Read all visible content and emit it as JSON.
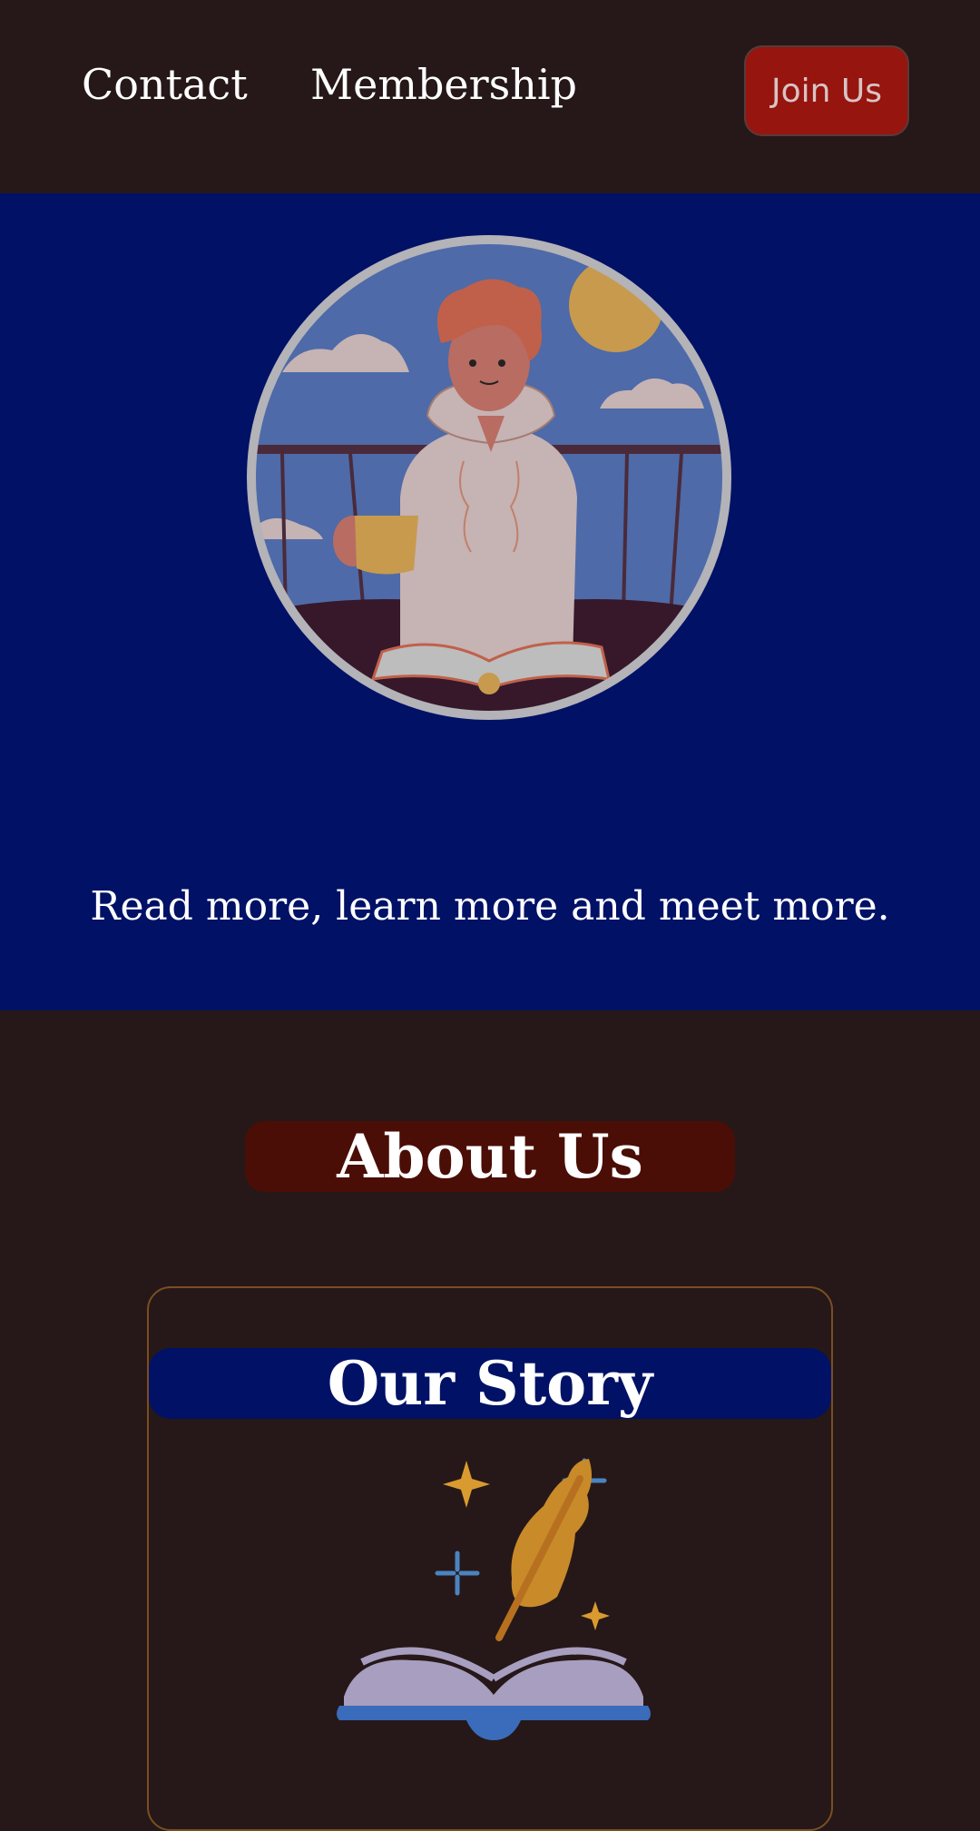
{
  "nav": {
    "links": [
      "Contact",
      "Membership"
    ],
    "cta_label": "Join Us"
  },
  "hero": {
    "tagline": "Read more, learn more and meet more."
  },
  "about": {
    "heading": "About Us"
  },
  "story": {
    "heading": "Our Story"
  },
  "colors": {
    "page_bg": "#261818",
    "hero_bg": "#001166",
    "cta_bg": "#96150f",
    "about_heading_bg": "#4a0e06",
    "story_border": "#7a4e22"
  },
  "icons": [
    "reader-illustration",
    "quill-book-illustration"
  ]
}
